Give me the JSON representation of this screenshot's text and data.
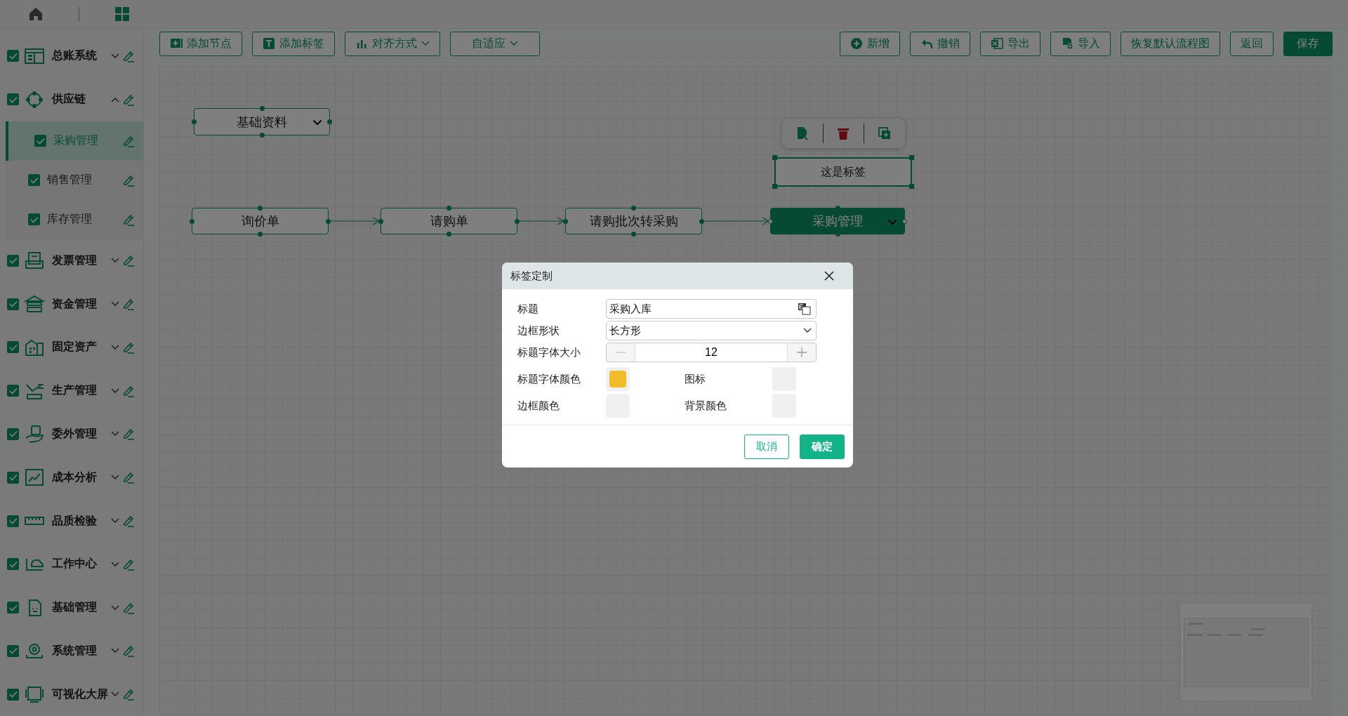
{
  "sidebar": {
    "items": [
      {
        "label": "总账系统",
        "checked": true,
        "expanded": false
      },
      {
        "label": "供应链",
        "checked": true,
        "expanded": true,
        "children": [
          {
            "label": "采购管理",
            "checked": true,
            "selected": true
          },
          {
            "label": "销售管理",
            "checked": true,
            "selected": false
          },
          {
            "label": "库存管理",
            "checked": true,
            "selected": false
          }
        ]
      },
      {
        "label": "发票管理",
        "checked": true,
        "expanded": false
      },
      {
        "label": "资金管理",
        "checked": true,
        "expanded": false
      },
      {
        "label": "固定资产",
        "checked": true,
        "expanded": false
      },
      {
        "label": "生产管理",
        "checked": true,
        "expanded": false
      },
      {
        "label": "委外管理",
        "checked": true,
        "expanded": false
      },
      {
        "label": "成本分析",
        "checked": true,
        "expanded": false
      },
      {
        "label": "品质检验",
        "checked": true,
        "expanded": false
      },
      {
        "label": "工作中心",
        "checked": true,
        "expanded": false
      },
      {
        "label": "基础管理",
        "checked": true,
        "expanded": false
      },
      {
        "label": "系统管理",
        "checked": true,
        "expanded": false
      },
      {
        "label": "可视化大屏",
        "checked": true,
        "expanded": false
      }
    ]
  },
  "toolbar": {
    "left": [
      {
        "label": "添加节点",
        "dropdown": false,
        "primary": false
      },
      {
        "label": "添加标签",
        "dropdown": false,
        "primary": false
      },
      {
        "label": "对齐方式",
        "dropdown": true,
        "primary": false
      },
      {
        "label": "自适应",
        "dropdown": true,
        "primary": false
      }
    ],
    "right": [
      {
        "label": "新增",
        "dropdown": false,
        "primary": false
      },
      {
        "label": "撤销",
        "dropdown": false,
        "primary": false
      },
      {
        "label": "导出",
        "dropdown": false,
        "primary": false
      },
      {
        "label": "导入",
        "dropdown": false,
        "primary": false
      },
      {
        "label": "恢复默认流程图",
        "dropdown": false,
        "primary": false
      },
      {
        "label": "返回",
        "dropdown": false,
        "primary": false
      },
      {
        "label": "保存",
        "dropdown": false,
        "primary": true
      }
    ]
  },
  "canvas": {
    "nodes": [
      {
        "label": "基础资料",
        "selected": false,
        "has_menu": true
      },
      {
        "label": "询价单",
        "selected": false,
        "has_menu": false
      },
      {
        "label": "请购单",
        "selected": false,
        "has_menu": false
      },
      {
        "label": "请购批次转采购",
        "selected": false,
        "has_menu": false
      },
      {
        "label": "采购管理",
        "selected": true,
        "has_menu": true
      }
    ],
    "label_node": {
      "text": "这是标签",
      "selected": true
    }
  },
  "dialog": {
    "title": "标签定制",
    "fields": [
      {
        "kind": "text",
        "label": "标题",
        "value": "采购入库"
      },
      {
        "kind": "select",
        "label": "边框形状",
        "value": "长方形"
      },
      {
        "kind": "stepper",
        "label": "标题字体大小",
        "value": "12"
      }
    ],
    "swatches": [
      {
        "label": "标题字体颜色",
        "color": "#f0bc2a"
      },
      {
        "label": "图标"
      },
      {
        "label": "边框颜色"
      },
      {
        "label": "背景颜色"
      }
    ],
    "buttons": [
      {
        "label": "取消",
        "primary": false
      },
      {
        "label": "确定",
        "primary": true
      }
    ]
  }
}
